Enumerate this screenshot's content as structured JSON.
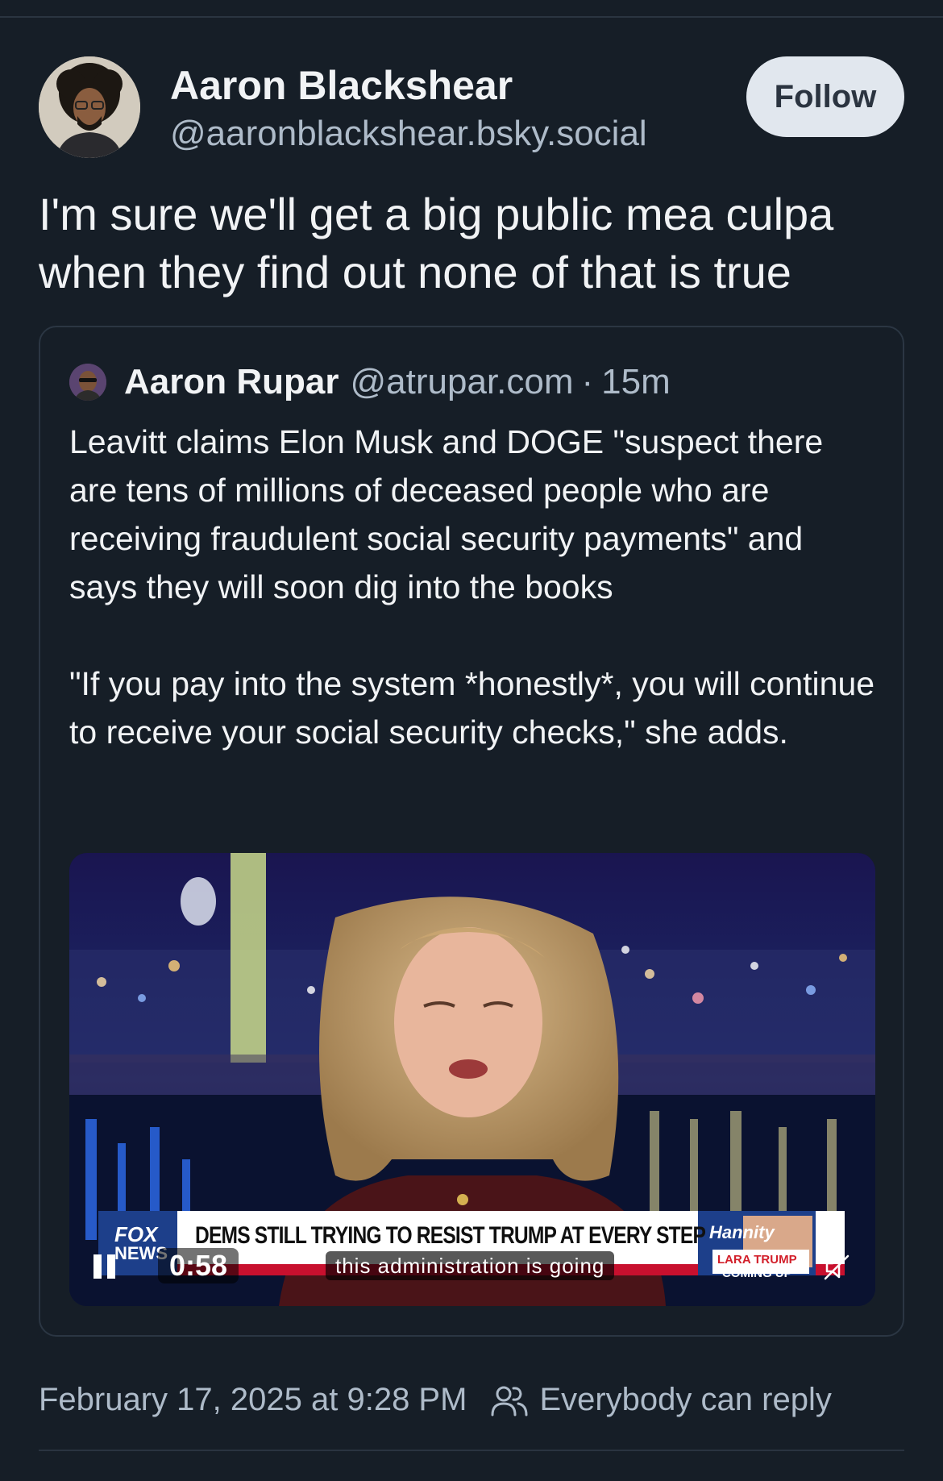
{
  "post": {
    "author": {
      "name": "Aaron Blackshear",
      "handle": "@aaronblackshear.bsky.social"
    },
    "follow_label": "Follow",
    "text": "I'm sure we'll get a big public mea culpa when they find out none of that is true",
    "timestamp": "February 17, 2025 at 9:28 PM",
    "reply_setting": "Everybody can reply"
  },
  "quote": {
    "author_name": "Aaron Rupar",
    "handle": "@atrupar.com",
    "separator": "·",
    "age": "15m",
    "paragraphs": [
      "Leavitt claims Elon Musk and DOGE \"suspect there are tens of millions of deceased people who are receiving fraudulent social security payments\" and says they will soon dig into the books",
      "\"If you pay into the system *honestly*, you will continue to receive your social security checks,\" she adds."
    ],
    "video": {
      "duration": "0:58",
      "caption": "this administration is going",
      "chyron": "DEMS STILL TRYING TO RESIST TRUMP AT EVERY STEP",
      "network_logo": "FOX",
      "network_sub": "NEWS",
      "show_tag": "Hannity",
      "promo_line1": "LARA TRUMP",
      "promo_line2": "COMING UP",
      "state": "playing",
      "muted": true
    }
  },
  "colors": {
    "background": "#161e27",
    "text_primary": "#f1f3f5",
    "text_secondary": "#aebbc9",
    "border": "#2b3643",
    "follow_bg": "#e1e7ee"
  }
}
